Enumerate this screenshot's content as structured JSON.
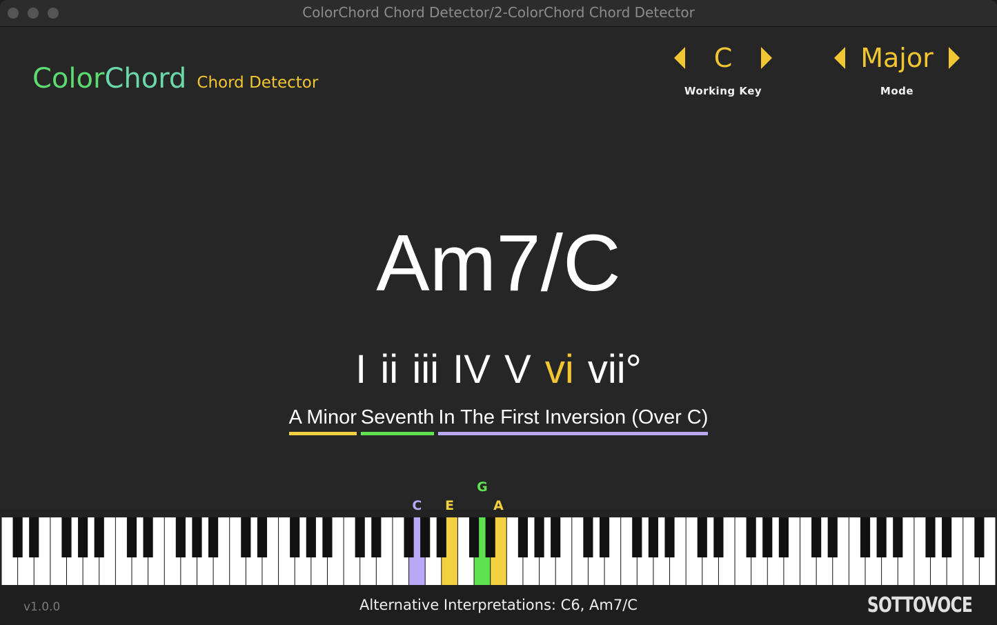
{
  "window": {
    "title": "ColorChord Chord Detector/2-ColorChord Chord Detector"
  },
  "logo": {
    "color_part": "Color",
    "chord_part": "Chord",
    "sub": "Chord Detector"
  },
  "working_key": {
    "value": "C",
    "label": "Working Key"
  },
  "mode": {
    "value": "Major",
    "label": "Mode"
  },
  "chord": {
    "name": "Am7/C"
  },
  "numerals": [
    {
      "text": "I",
      "active": false
    },
    {
      "text": "ii",
      "active": false
    },
    {
      "text": "iii",
      "active": false
    },
    {
      "text": "IV",
      "active": false
    },
    {
      "text": "V",
      "active": false
    },
    {
      "text": "vi",
      "active": true
    },
    {
      "text": "vii°",
      "active": false
    }
  ],
  "description": [
    {
      "text": "A Minor",
      "color": "#f2d140"
    },
    {
      "text": "Seventh",
      "color": "#5ee24f"
    },
    {
      "text": "In The First Inversion (Over C)",
      "color": "#b9a8f5"
    }
  ],
  "active_notes": [
    {
      "label": "C",
      "white_index": 25,
      "color": "#b9a8f5"
    },
    {
      "label": "E",
      "white_index": 27,
      "color": "#f2d140"
    },
    {
      "label": "G",
      "white_index": 29,
      "color": "#5ee24f"
    },
    {
      "label": "A",
      "white_index": 30,
      "color": "#f2d140"
    }
  ],
  "status": {
    "version": "v1.0.0",
    "alternatives": "Alternative Interpretations: C6, Am7/C",
    "brand": "SOTTOVOCE"
  },
  "colors": {
    "accent": "#f2c632",
    "root": "#f2d140",
    "quality": "#5ee24f",
    "bass": "#b9a8f5"
  }
}
